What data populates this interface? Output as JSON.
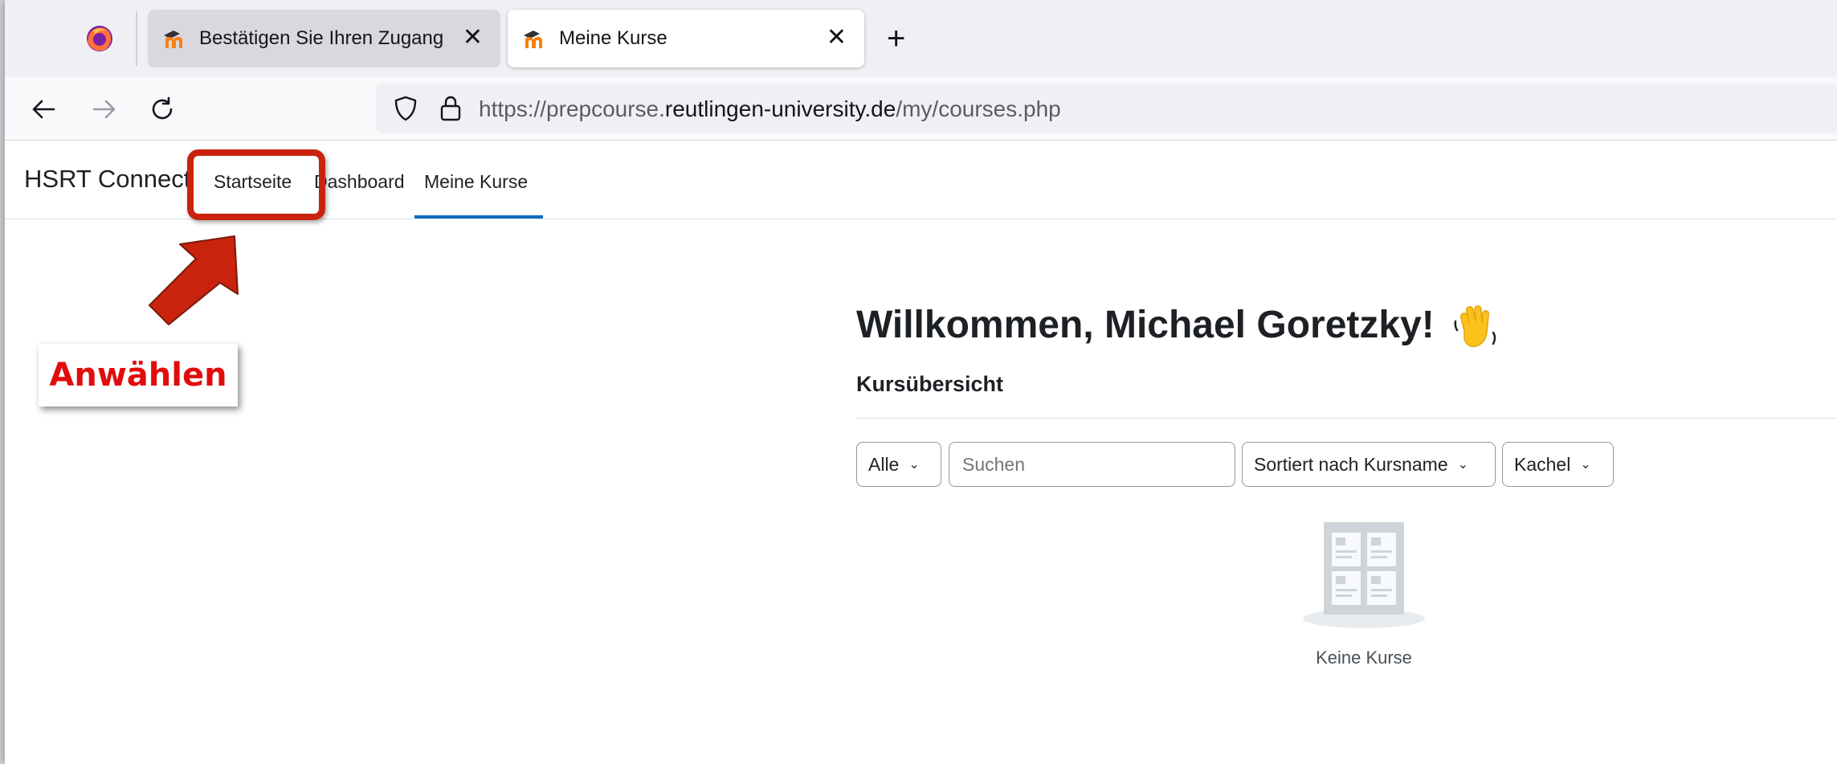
{
  "browser": {
    "tabs": [
      {
        "title": "Bestätigen Sie Ihren Zugang",
        "state": "inactive"
      },
      {
        "title": "Meine Kurse",
        "state": "active"
      }
    ],
    "close_glyph": "✕",
    "new_tab_glyph": "+",
    "url": {
      "prefix": "https://prepcourse.",
      "host": "reutlingen-university.de",
      "path": "/my/courses.php"
    }
  },
  "site": {
    "brand": "HSRT Connect",
    "nav": [
      "Startseite",
      "Dashboard",
      "Meine Kurse"
    ],
    "active_nav": "Meine Kurse"
  },
  "main": {
    "welcome": "Willkommen, Michael Goretzky!",
    "section_title": "Kursübersicht",
    "filters": {
      "grouping": "Alle",
      "search_placeholder": "Suchen",
      "sort": "Sortiert nach Kursname",
      "view": "Kachel"
    },
    "empty_state": "Keine Kurse"
  },
  "annotation": {
    "callout_text": "Anwählen",
    "color": "#c9230e"
  },
  "colors": {
    "accent": "#0f6cbf",
    "annotation_red": "#e20c0c"
  },
  "icons": [
    "firefox-icon",
    "moodle-favicon",
    "back-icon",
    "forward-icon",
    "reload-icon",
    "shield-icon",
    "lock-icon",
    "waving-hand-icon",
    "course-placeholder-icon"
  ]
}
